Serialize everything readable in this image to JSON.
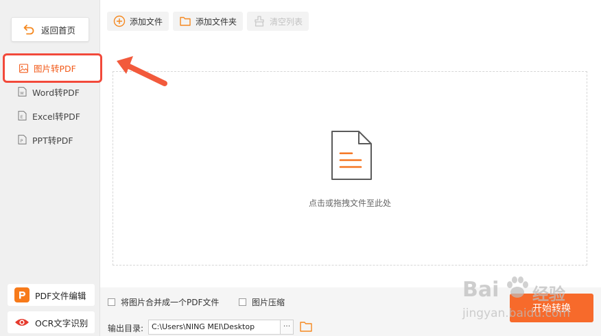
{
  "sidebar": {
    "back_label": "返回首页",
    "items": [
      {
        "label": "图片转PDF",
        "active": true
      },
      {
        "label": "Word转PDF"
      },
      {
        "label": "Excel转PDF"
      },
      {
        "label": "PPT转PDF"
      }
    ],
    "tools": [
      {
        "label": "PDF文件编辑",
        "badge_color": "#f77a1a"
      },
      {
        "label": "OCR文字识别",
        "badge_color": "#e63b2e"
      }
    ]
  },
  "toolbar": {
    "add_file": "添加文件",
    "add_folder": "添加文件夹",
    "clear_list": "清空列表"
  },
  "drop_zone": {
    "hint": "点击或拖拽文件至此处"
  },
  "options": {
    "merge_label": "将图片合并成一个PDF文件",
    "compress_label": "图片压缩"
  },
  "output": {
    "label": "输出目录:",
    "path": "C:\\Users\\NING MEI\\Desktop",
    "more": "···"
  },
  "start_label": "开始转换",
  "watermark": {
    "brand": "Bai",
    "brand2": "经验",
    "url": "jingyan.baidu.com"
  },
  "colors": {
    "accent": "#f76a2b",
    "highlight": "#f2493a"
  }
}
